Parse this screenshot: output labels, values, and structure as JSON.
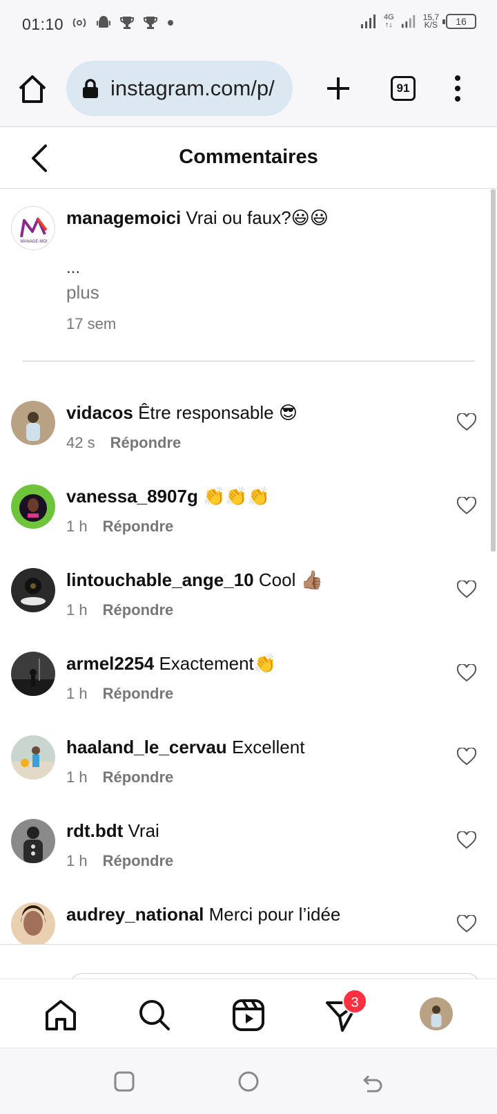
{
  "status_bar": {
    "time": "01:10",
    "network": "4G",
    "speed_value": "15,7",
    "speed_unit": "K/S",
    "battery": "16"
  },
  "browser": {
    "url": "instagram.com/p/",
    "tab_count": "91"
  },
  "header": {
    "title": "Commentaires"
  },
  "caption": {
    "username": "managemoici",
    "text": "Vrai ou faux?😃😃",
    "ellipsis": "...",
    "more_label": "plus",
    "time": "17 sem",
    "logo_text": "MANAGE-MOI"
  },
  "comments": [
    {
      "username": "vidacos",
      "text": "Être responsable 😎",
      "time": "42 s",
      "reply_label": "Répondre",
      "avatar_color": "#b8a283"
    },
    {
      "username": "vanessa_8907g",
      "text": "👏👏👏",
      "time": "1 h",
      "reply_label": "Répondre",
      "avatar_color": "#6ec43a"
    },
    {
      "username": "lintouchable_ange_10",
      "text": "Cool 👍🏽",
      "time": "1 h",
      "reply_label": "Répondre",
      "avatar_color": "#2a2a2a"
    },
    {
      "username": "armel2254",
      "text": "Exactement👏",
      "time": "1 h",
      "reply_label": "Répondre",
      "avatar_color": "#3c3c3c"
    },
    {
      "username": "haaland_le_cervau",
      "text": "Excellent",
      "time": "1 h",
      "reply_label": "Répondre",
      "avatar_color": "#c9d6cf"
    },
    {
      "username": "rdt.bdt",
      "text": "Vrai",
      "time": "1 h",
      "reply_label": "Répondre",
      "avatar_color": "#8a8a8a"
    },
    {
      "username": "audrey_national",
      "text": "Merci pour l’idée",
      "time": "",
      "reply_label": "",
      "avatar_color": "#a0705a"
    }
  ],
  "bottom_nav": {
    "items": [
      "home",
      "search",
      "reels",
      "direct",
      "profile"
    ],
    "direct_badge": "3"
  },
  "colors": {
    "badge": "#ff3040",
    "url_bar": "#dbe8f1",
    "muted_text": "#777777"
  }
}
